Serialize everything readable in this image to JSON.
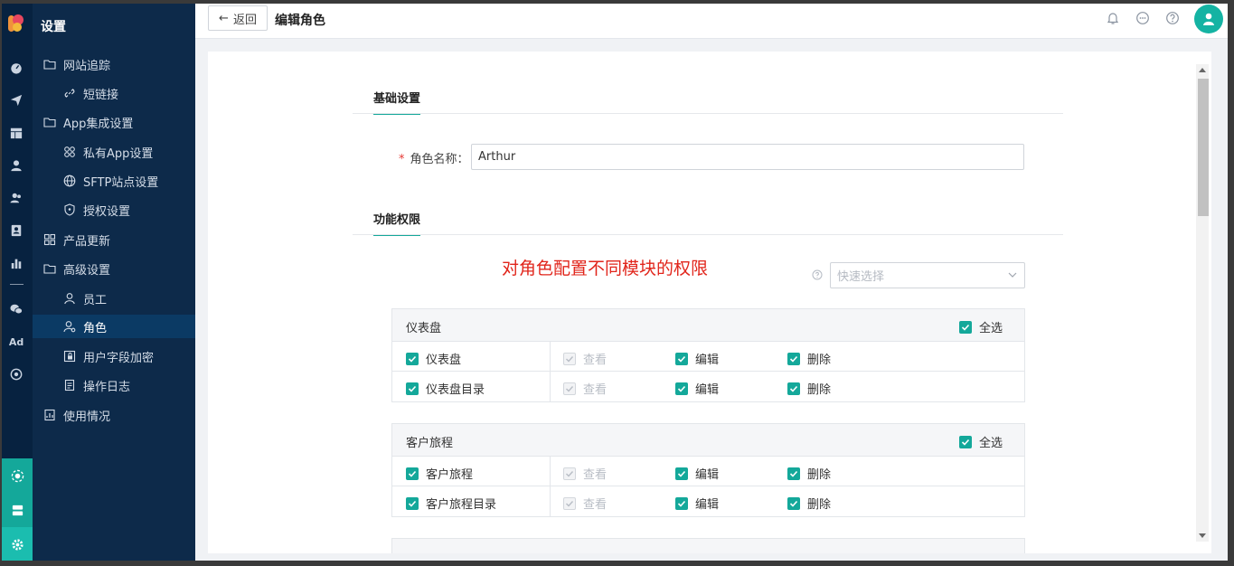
{
  "sidebar": {
    "title": "设置",
    "items": [
      {
        "label": "网站追踪",
        "icon": "folder-icon",
        "level": 1
      },
      {
        "label": "短链接",
        "icon": "link-icon",
        "level": 2
      },
      {
        "label": "App集成设置",
        "icon": "folder-icon",
        "level": 1
      },
      {
        "label": "私有App设置",
        "icon": "apps-icon",
        "level": 2
      },
      {
        "label": "SFTP站点设置",
        "icon": "globe-icon",
        "level": 2
      },
      {
        "label": "授权设置",
        "icon": "shield-icon",
        "level": 2
      },
      {
        "label": "产品更新",
        "icon": "grid-icon",
        "level": 1
      },
      {
        "label": "高级设置",
        "icon": "folder-icon",
        "level": 1
      },
      {
        "label": "员工",
        "icon": "user-icon",
        "level": 2
      },
      {
        "label": "角色",
        "icon": "user-role-icon",
        "level": 2,
        "active": true
      },
      {
        "label": "用户字段加密",
        "icon": "encrypt-icon",
        "level": 2
      },
      {
        "label": "操作日志",
        "icon": "log-icon",
        "level": 2
      },
      {
        "label": "使用情况",
        "icon": "usage-icon",
        "level": 1
      }
    ]
  },
  "rail": {
    "ad_label": "Ad"
  },
  "header": {
    "back_label": "返回",
    "title": "编辑角色"
  },
  "form": {
    "basic_section": "基础设置",
    "role_name_label": "角色名称：",
    "role_name_value": "Arthur",
    "perm_section": "功能权限",
    "annotation": "对角色配置不同模块的权限",
    "quick_select_placeholder": "快速选择"
  },
  "permissions": {
    "select_all_label": "全选",
    "view_label": "查看",
    "edit_label": "编辑",
    "delete_label": "删除",
    "blocks": [
      {
        "name": "仪表盘",
        "rows": [
          "仪表盘",
          "仪表盘目录"
        ]
      },
      {
        "name": "客户旅程",
        "rows": [
          "客户旅程",
          "客户旅程目录"
        ]
      }
    ]
  },
  "colors": {
    "accent": "#14a89a",
    "rail_bg": "#072240",
    "sidebar_bg": "#0d2a4a",
    "annotation": "#e1251b"
  }
}
